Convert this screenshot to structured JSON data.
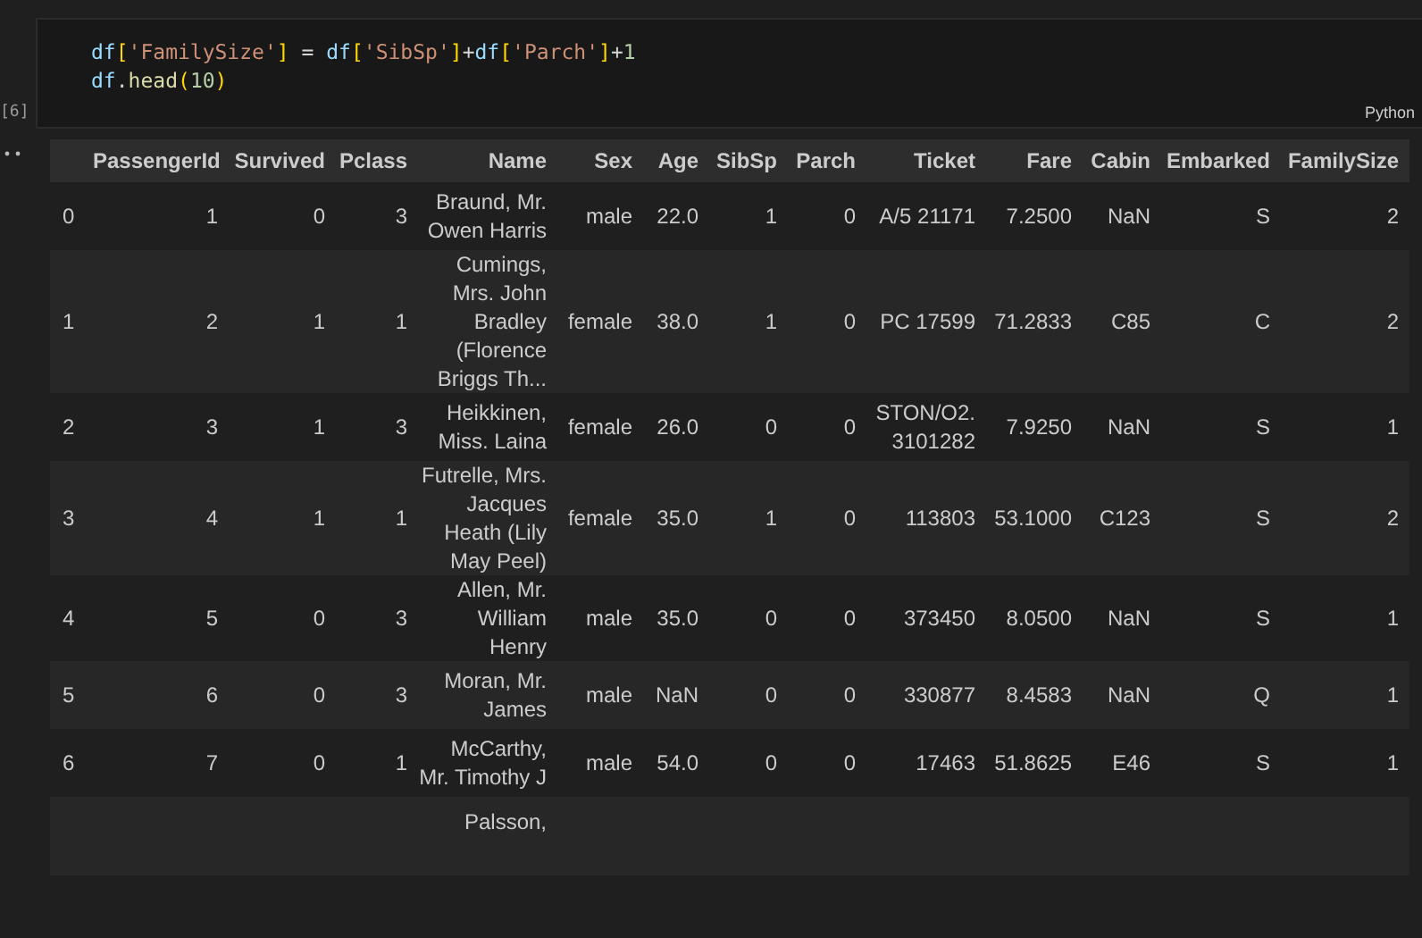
{
  "code_cell": {
    "execution_count": "[6]",
    "language": "Python",
    "lines": [
      [
        {
          "kind": "var",
          "text": "df"
        },
        {
          "kind": "bracket",
          "text": "["
        },
        {
          "kind": "string",
          "text": "'FamilySize'"
        },
        {
          "kind": "bracket",
          "text": "]"
        },
        {
          "kind": "op",
          "text": " = "
        },
        {
          "kind": "var",
          "text": "df"
        },
        {
          "kind": "bracket",
          "text": "["
        },
        {
          "kind": "string",
          "text": "'SibSp'"
        },
        {
          "kind": "bracket",
          "text": "]"
        },
        {
          "kind": "op",
          "text": "+"
        },
        {
          "kind": "var",
          "text": "df"
        },
        {
          "kind": "bracket",
          "text": "["
        },
        {
          "kind": "string",
          "text": "'Parch'"
        },
        {
          "kind": "bracket",
          "text": "]"
        },
        {
          "kind": "op",
          "text": "+"
        },
        {
          "kind": "number",
          "text": "1"
        }
      ],
      [
        {
          "kind": "var",
          "text": "df"
        },
        {
          "kind": "op",
          "text": "."
        },
        {
          "kind": "func",
          "text": "head"
        },
        {
          "kind": "bracket",
          "text": "("
        },
        {
          "kind": "number",
          "text": "10"
        },
        {
          "kind": "bracket",
          "text": ")"
        }
      ]
    ]
  },
  "output_table": {
    "columns": [
      "",
      "PassengerId",
      "Survived",
      "Pclass",
      "Name",
      "Sex",
      "Age",
      "SibSp",
      "Parch",
      "Ticket",
      "Fare",
      "Cabin",
      "Embarked",
      "FamilySize"
    ],
    "rows": [
      [
        "0",
        "1",
        "0",
        "3",
        "Braund, Mr. Owen Harris",
        "male",
        "22.0",
        "1",
        "0",
        "A/5 21171",
        "7.2500",
        "NaN",
        "S",
        "2"
      ],
      [
        "1",
        "2",
        "1",
        "1",
        "Cumings, Mrs. John Bradley (Florence Briggs Th...",
        "female",
        "38.0",
        "1",
        "0",
        "PC 17599",
        "71.2833",
        "C85",
        "C",
        "2"
      ],
      [
        "2",
        "3",
        "1",
        "3",
        "Heikkinen, Miss. Laina",
        "female",
        "26.0",
        "0",
        "0",
        "STON/O2. 3101282",
        "7.9250",
        "NaN",
        "S",
        "1"
      ],
      [
        "3",
        "4",
        "1",
        "1",
        "Futrelle, Mrs. Jacques Heath (Lily May Peel)",
        "female",
        "35.0",
        "1",
        "0",
        "113803",
        "53.1000",
        "C123",
        "S",
        "2"
      ],
      [
        "4",
        "5",
        "0",
        "3",
        "Allen, Mr. William Henry",
        "male",
        "35.0",
        "0",
        "0",
        "373450",
        "8.0500",
        "NaN",
        "S",
        "1"
      ],
      [
        "5",
        "6",
        "0",
        "3",
        "Moran, Mr. James",
        "male",
        "NaN",
        "0",
        "0",
        "330877",
        "8.4583",
        "NaN",
        "Q",
        "1"
      ],
      [
        "6",
        "7",
        "0",
        "1",
        "McCarthy, Mr. Timothy J",
        "male",
        "54.0",
        "0",
        "0",
        "17463",
        "51.8625",
        "E46",
        "S",
        "1"
      ]
    ],
    "cut_row": {
      "name": "Palsson,"
    }
  }
}
